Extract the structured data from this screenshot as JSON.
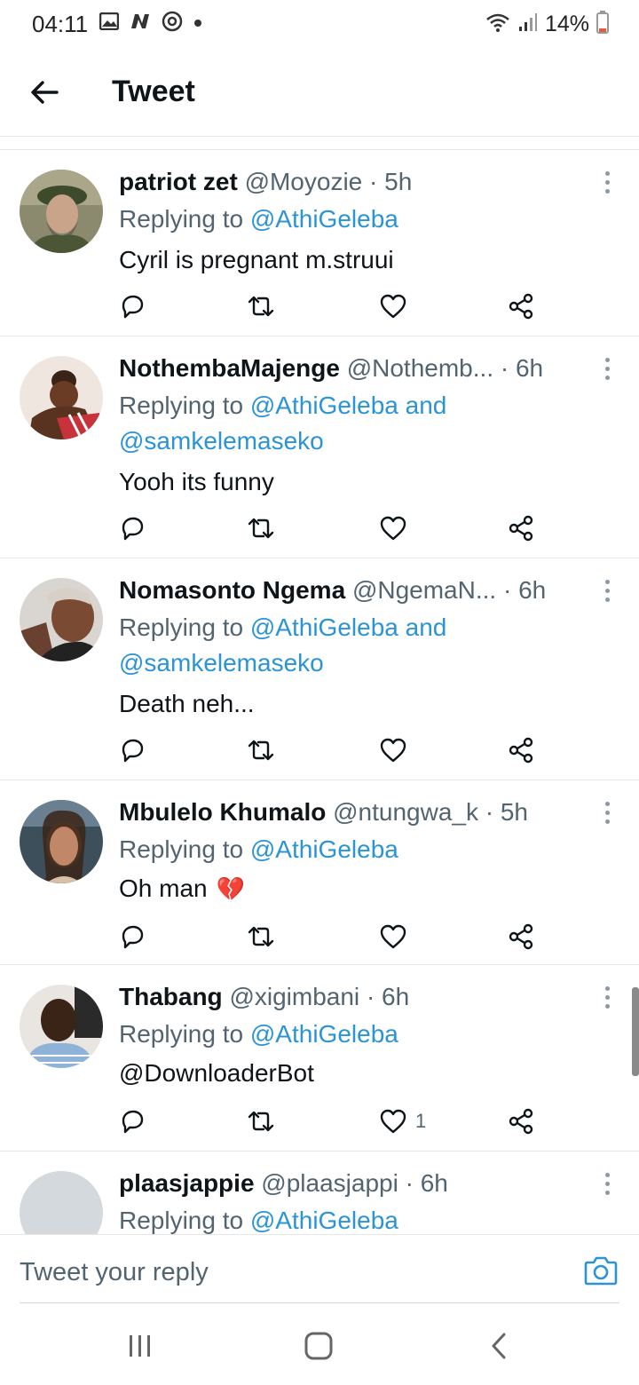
{
  "status_bar": {
    "time": "04:11",
    "left_icons": [
      "gallery-icon",
      "n-app-icon",
      "vpn-icon",
      "dot-icon"
    ],
    "right_icons": [
      "wifi-icon",
      "signal-icon"
    ],
    "battery": "14%"
  },
  "header": {
    "title": "Tweet",
    "back_icon": "arrow-left-icon"
  },
  "tweets": [
    {
      "name": "patriot zet",
      "handle": "@Moyozie",
      "time": "· 5h",
      "replying_prefix": "Replying to ",
      "replying_mentions": "@AthiGeleba",
      "replying_line2": "",
      "text": "Cyril is pregnant m.struui",
      "likes": ""
    },
    {
      "name": "NothembaMajenge",
      "handle": "@Nothemb...",
      "time": "· 6h",
      "replying_prefix": "Replying to ",
      "replying_mentions": "@AthiGeleba and",
      "replying_line2": "@samkelemaseko",
      "text": "Yooh its funny",
      "likes": ""
    },
    {
      "name": "Nomasonto Ngema",
      "handle": "@NgemaN...",
      "time": "· 6h",
      "replying_prefix": "Replying to ",
      "replying_mentions": "@AthiGeleba and",
      "replying_line2": "@samkelemaseko",
      "text": "Death neh...",
      "likes": ""
    },
    {
      "name": "Mbulelo Khumalo",
      "handle": "@ntungwa_k",
      "time": "· 5h",
      "replying_prefix": "Replying to ",
      "replying_mentions": "@AthiGeleba",
      "replying_line2": "",
      "text": "Oh man",
      "emoji": "💔",
      "likes": ""
    },
    {
      "name": "Thabang",
      "handle": "@xigimbani",
      "time": "· 6h",
      "replying_prefix": "Replying to ",
      "replying_mentions": "@AthiGeleba",
      "replying_line2": "",
      "text": "@DownloaderBot",
      "likes": "1"
    },
    {
      "name": "plaasjappie",
      "handle": "@plaasjappi",
      "time": "· 6h",
      "replying_prefix": "Replying to ",
      "replying_mentions": "@AthiGeleba",
      "replying_line2": "",
      "text": "",
      "likes": ""
    }
  ],
  "reply_bar": {
    "placeholder": "Tweet your reply",
    "camera_icon": "camera-icon"
  },
  "nav_bar": {
    "icons": [
      "recents-icon",
      "home-icon",
      "back-icon"
    ]
  },
  "colors": {
    "link": "#2b94d6",
    "secondary_text": "#536471",
    "divider": "#e6e6e6"
  }
}
